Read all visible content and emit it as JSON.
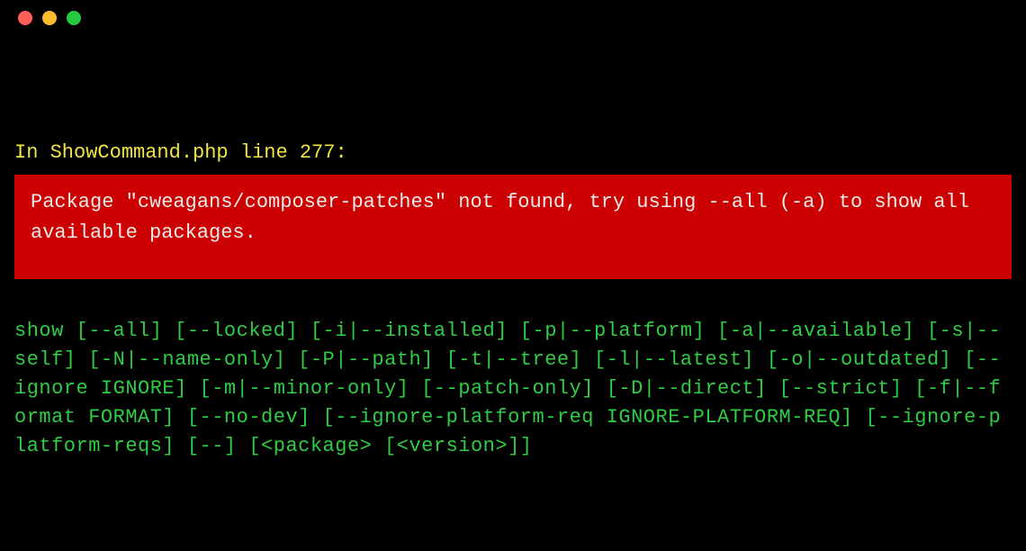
{
  "titlebar": {
    "close": "close",
    "minimize": "minimize",
    "zoom": "zoom"
  },
  "terminal": {
    "error_context": "In ShowCommand.php line 277:",
    "error_message": "Package \"cweagans/composer-patches\" not found, try using --all (-a) to show all available packages.",
    "usage": "show [--all] [--locked] [-i|--installed] [-p|--platform] [-a|--available] [-s|--self] [-N|--name-only] [-P|--path] [-t|--tree] [-l|--latest] [-o|--outdated] [--ignore IGNORE] [-m|--minor-only] [--patch-only] [-D|--direct] [--strict] [-f|--format FORMAT] [--no-dev] [--ignore-platform-req IGNORE-PLATFORM-REQ] [--ignore-platform-reqs] [--] [<package> [<version>]]"
  },
  "colors": {
    "bg": "#000000",
    "yellow": "#f0e442",
    "red_bg": "#cc0000",
    "red_fg": "#eaeaea",
    "green": "#2fcc44"
  }
}
